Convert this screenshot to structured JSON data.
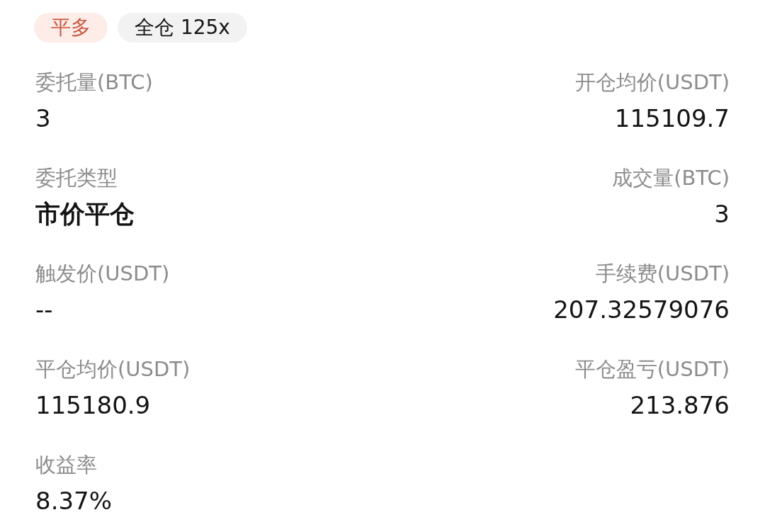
{
  "tags": [
    {
      "label": "平多",
      "kind": "side"
    },
    {
      "label": "全仓 125x",
      "kind": "margin"
    }
  ],
  "rows": [
    {
      "left": {
        "label": "委托量(BTC)",
        "value": "3",
        "kind": "number"
      },
      "right": {
        "label": "开仓均价(USDT)",
        "value": "115109.7",
        "kind": "number"
      }
    },
    {
      "left": {
        "label": "委托类型",
        "value": "市价平仓",
        "kind": "text"
      },
      "right": {
        "label": "成交量(BTC)",
        "value": "3",
        "kind": "number"
      }
    },
    {
      "left": {
        "label": "触发价(USDT)",
        "value": "--",
        "kind": "number"
      },
      "right": {
        "label": "手续费(USDT)",
        "value": "207.32579076",
        "kind": "number"
      }
    },
    {
      "left": {
        "label": "平仓均价(USDT)",
        "value": "115180.9",
        "kind": "number"
      },
      "right": {
        "label": "平仓盈亏(USDT)",
        "value": "213.876",
        "kind": "number"
      }
    },
    {
      "left": {
        "label": "收益率",
        "value": "8.37%",
        "kind": "number"
      }
    }
  ]
}
